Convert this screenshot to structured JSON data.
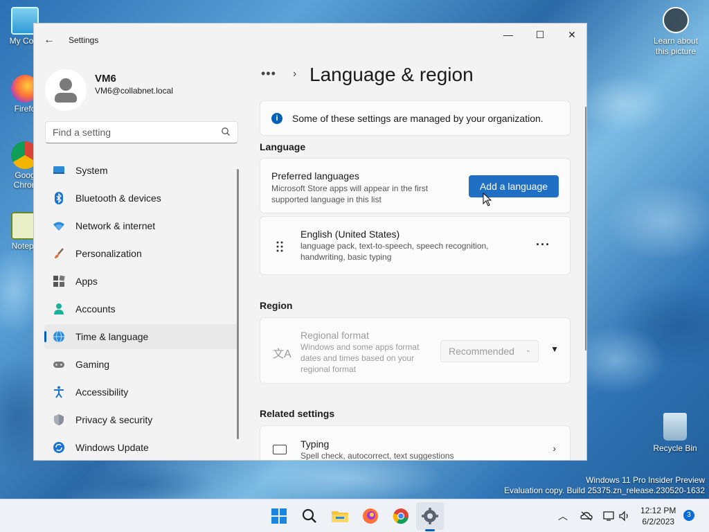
{
  "desktop": {
    "icons": [
      {
        "label": "My Com"
      },
      {
        "label": "Firefo"
      },
      {
        "label": "Goog Chron"
      },
      {
        "label": "Notepa"
      }
    ],
    "learn_label": "Learn about this picture",
    "recycle_label": "Recycle Bin",
    "watermark_line1": "Windows 11 Pro Insider Preview",
    "watermark_line2": "Evaluation copy. Build 25375.zn_release.230520-1632"
  },
  "window": {
    "title": "Settings",
    "minimize": "—",
    "maximize": "☐",
    "close": "✕"
  },
  "user": {
    "name": "VM6",
    "email": "VM6@collabnet.local"
  },
  "search": {
    "placeholder": "Find a setting"
  },
  "nav": {
    "items": [
      {
        "label": "System",
        "icon": "system-icon"
      },
      {
        "label": "Bluetooth & devices",
        "icon": "bluetooth-icon"
      },
      {
        "label": "Network & internet",
        "icon": "network-icon"
      },
      {
        "label": "Personalization",
        "icon": "brush-icon"
      },
      {
        "label": "Apps",
        "icon": "apps-icon"
      },
      {
        "label": "Accounts",
        "icon": "accounts-icon"
      },
      {
        "label": "Time & language",
        "icon": "globe-clock-icon",
        "active": true
      },
      {
        "label": "Gaming",
        "icon": "gamepad-icon"
      },
      {
        "label": "Accessibility",
        "icon": "accessibility-icon"
      },
      {
        "label": "Privacy & security",
        "icon": "shield-icon"
      },
      {
        "label": "Windows Update",
        "icon": "update-icon"
      }
    ]
  },
  "main": {
    "breadcrumb_dots": "•••",
    "breadcrumb_sep": "›",
    "page_title": "Language & region",
    "info_text": "Some of these settings are managed by your organization.",
    "language_header": "Language",
    "preferred_title": "Preferred languages",
    "preferred_desc": "Microsoft Store apps will appear in the first supported language in this list",
    "add_language": "Add a language",
    "english_name": "English (United States)",
    "english_desc": "language pack, text-to-speech, speech recognition, handwriting, basic typing",
    "more_glyph": "···",
    "region_header": "Region",
    "regional_title": "Regional format",
    "regional_desc": "Windows and some apps format dates and times based on your regional format",
    "regional_value": "Recommended",
    "related_header": "Related settings",
    "typing_title": "Typing",
    "typing_desc": "Spell check, autocorrect, text suggestions"
  },
  "taskbar": {
    "time": "12:12 PM",
    "date": "6/2/2023",
    "notifications": "3"
  },
  "colors": {
    "accent": "#1f6fc5",
    "window_bg": "#f3f3f3",
    "card_bg": "#fbfbfb"
  }
}
